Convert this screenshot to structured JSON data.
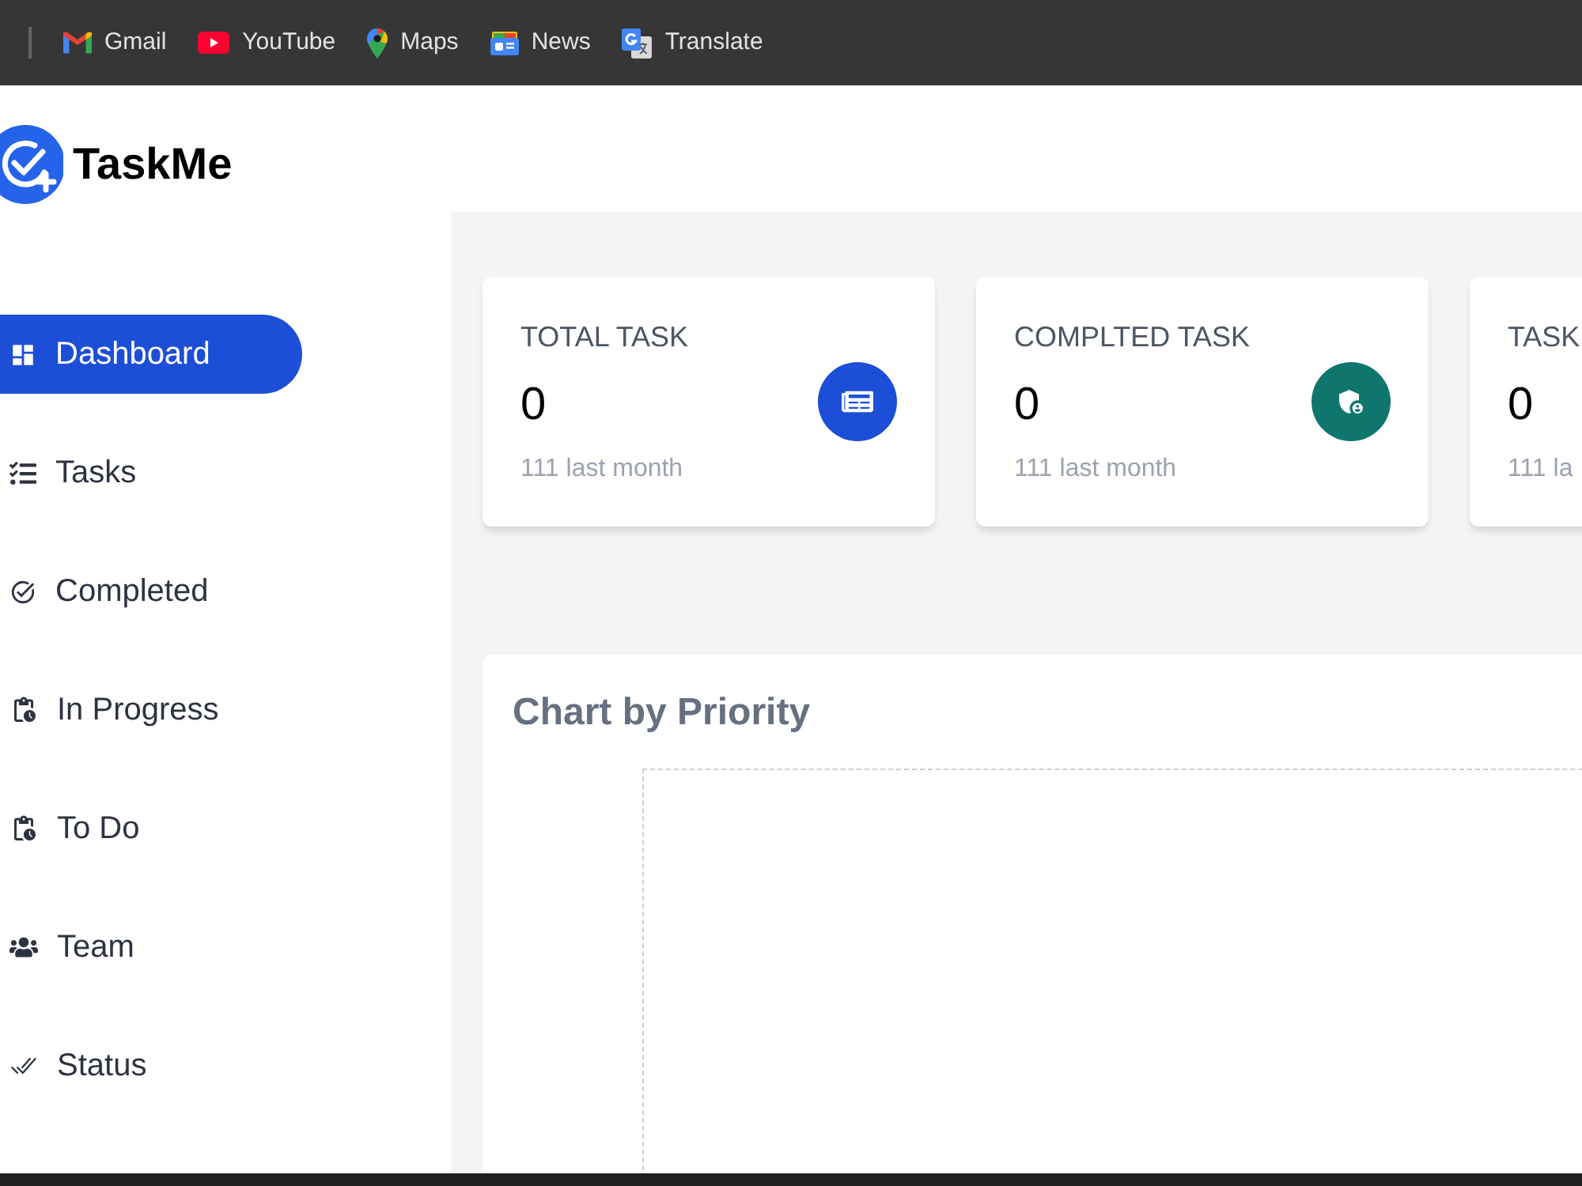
{
  "bookmarks": [
    {
      "label": "Gmail",
      "kind": "gmail"
    },
    {
      "label": "YouTube",
      "kind": "youtube"
    },
    {
      "label": "Maps",
      "kind": "maps"
    },
    {
      "label": "News",
      "kind": "news"
    },
    {
      "label": "Translate",
      "kind": "translate"
    }
  ],
  "logo": {
    "text": "TaskMe"
  },
  "sidebar": {
    "items": [
      {
        "label": "Dashboard",
        "selected": true
      },
      {
        "label": "Tasks",
        "selected": false
      },
      {
        "label": "Completed",
        "selected": false
      },
      {
        "label": "In Progress",
        "selected": false
      },
      {
        "label": "To Do",
        "selected": false
      },
      {
        "label": "Team",
        "selected": false
      },
      {
        "label": "Status",
        "selected": false
      }
    ]
  },
  "stats": [
    {
      "title": "TOTAL TASK",
      "value": "0",
      "note": "111 last month",
      "color": "#1d4ed8"
    },
    {
      "title": "COMPLTED TASK",
      "value": "0",
      "note": "111 last month",
      "color": "#0f766e"
    },
    {
      "title": "TASK",
      "value": "0",
      "note": "111 la"
    }
  ],
  "chart": {
    "title": "Chart by Priority"
  }
}
